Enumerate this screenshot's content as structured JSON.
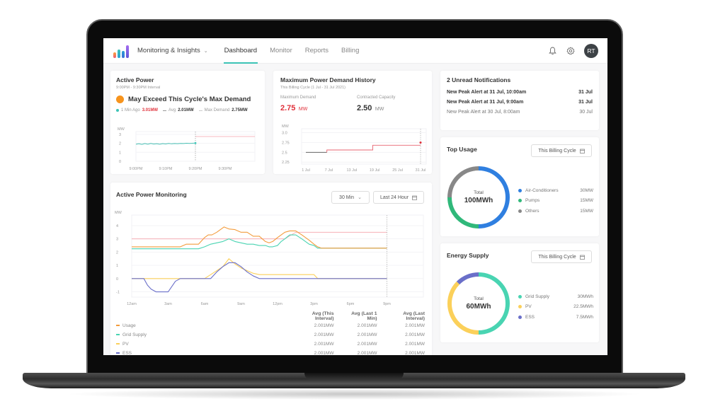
{
  "nav": {
    "module": "Monitoring & Insights",
    "tabs": [
      "Dashboard",
      "Monitor",
      "Reports",
      "Billing"
    ],
    "active_tab": "Dashboard",
    "avatar_initials": "RT",
    "icons": [
      "bell-icon",
      "gear-icon"
    ]
  },
  "colors": {
    "accent": "#3cc3b6",
    "usage": "#f39c3c",
    "grid_supply": "#49d4b2",
    "pv": "#fbd05a",
    "ess": "#6a6fc9",
    "alert_red": "#e0303a",
    "air_conditioners": "#2f7fe0",
    "pumps": "#30b87a",
    "others": "#888888"
  },
  "active_power": {
    "title": "Active Power",
    "interval": "9:00PM - 9:30PM Interval",
    "warning": "May Exceed This Cycle's Max Demand",
    "last_label": "1 Min Ago",
    "last_value": "3.01MW",
    "avg_label": "Avg",
    "avg_value": "2.01MW",
    "max_label": "Max Demand",
    "max_value": "2.75MW",
    "chart_data": {
      "type": "line",
      "ylabel": "MW",
      "yticks": [
        "3",
        "2",
        "1",
        "0"
      ],
      "ylim": [
        0,
        3.3
      ],
      "xticks": [
        "9:00PM",
        "9:10PM",
        "9:20PM",
        "9:30PM"
      ],
      "series": [
        {
          "name": "Usage",
          "x": [
            0,
            1,
            2,
            3,
            4,
            5,
            6,
            7,
            8,
            9,
            10,
            11,
            12,
            13,
            14,
            15,
            16,
            17,
            18,
            19,
            20
          ],
          "values": [
            1.9,
            1.95,
            1.88,
            1.97,
            1.9,
            1.98,
            1.92,
            1.95,
            1.9,
            1.96,
            1.93,
            1.98,
            1.94,
            1.97,
            1.95,
            1.98,
            1.97,
            2.0,
            1.98,
            2.0,
            2.02
          ]
        }
      ],
      "max_demand_line": 2.75,
      "current_marker_min": 20,
      "x_range_min": [
        0,
        40
      ]
    }
  },
  "max_demand": {
    "title": "Maximum Power Demand History",
    "subtitle": "This Billing Cycle (1 Jul - 31 Jul 2021)",
    "max_demand_label": "Maximum Demand",
    "max_demand_value": "2.75",
    "contracted_label": "Contracted Capacity",
    "contracted_value": "2.50",
    "unit": "MW",
    "chart_data": {
      "type": "line",
      "ylabel": "MW",
      "yticks": [
        "3.0",
        "2.75",
        "2.5",
        "2.25"
      ],
      "ylim": [
        2.2,
        3.1
      ],
      "xticks": [
        "1 Jul",
        "7 Jul",
        "13 Jul",
        "19 Jul",
        "25 Jul",
        "31 Jul"
      ],
      "steps": [
        {
          "day_from": 1,
          "day_to": 6.5,
          "value": 2.5
        },
        {
          "day_from": 6.5,
          "day_to": 18.5,
          "value": 2.56
        },
        {
          "day_from": 18.5,
          "day_to": 31,
          "value": 2.68
        }
      ],
      "marker": {
        "day": 31,
        "value": 2.75
      }
    }
  },
  "notifications": {
    "title": "2 Unread Notifications",
    "items": [
      {
        "text": "New Peak Alert at 31 Jul, 10:00am",
        "date": "31 Jul",
        "unread": true
      },
      {
        "text": "New Peak Alert at 31 Jul, 9:00am",
        "date": "31 Jul",
        "unread": true
      },
      {
        "text": "New Peak Alert at 30 Jul, 8:00am",
        "date": "30 Jul",
        "unread": false
      }
    ]
  },
  "top_usage": {
    "title": "Top Usage",
    "period": "This Billing Cycle",
    "total_label": "Total",
    "total_value": "100MWh",
    "chart_data": {
      "type": "pie",
      "labels": [
        "Air-Conditioners",
        "Pumps",
        "Others"
      ],
      "values": [
        50,
        25,
        25
      ],
      "display": [
        "30MW",
        "15MW",
        "15MW"
      ]
    }
  },
  "energy_supply": {
    "title": "Energy Supply",
    "period": "This Billing Cycle",
    "total_label": "Total",
    "total_value": "60MWh",
    "chart_data": {
      "type": "pie",
      "labels": [
        "Grid Supply",
        "PV",
        "ESS"
      ],
      "values": [
        30,
        22.5,
        7.5
      ],
      "display": [
        "30MWh",
        "22.5MWh",
        "7.5MWh"
      ]
    }
  },
  "monitoring": {
    "title": "Active Power Monitoring",
    "interval_select": "30 Min",
    "range_select": "Last 24 Hour",
    "chart_data": {
      "type": "line",
      "ylabel": "MW",
      "yticks": [
        "4",
        "3",
        "2",
        "1",
        "0",
        "-1"
      ],
      "ylim": [
        -1.4,
        4.8
      ],
      "xticks": [
        "12am",
        "3am",
        "6am",
        "9am",
        "12pm",
        "3pm",
        "6pm",
        "9pm"
      ],
      "x_range_hours": [
        0,
        24
      ],
      "now_hour": 21,
      "threshold": {
        "name": "Max Demand",
        "value": 3,
        "later_value": 3.5,
        "step_hour": 13.5
      },
      "series": [
        {
          "name": "Usage",
          "hours": [
            0,
            1,
            2,
            3,
            4,
            4.5,
            5,
            5.5,
            6,
            6.3,
            6.6,
            7,
            7.3,
            7.6,
            8,
            8.5,
            9,
            9.5,
            10,
            10.5,
            11,
            11.3,
            11.6,
            12,
            12.3,
            12.6,
            13,
            13.5,
            14,
            14.3,
            14.6,
            15,
            15.3,
            15.6,
            16,
            18,
            21
          ],
          "values": [
            2.4,
            2.4,
            2.4,
            2.4,
            2.4,
            2.6,
            2.6,
            2.6,
            3.1,
            3.3,
            3.3,
            3.5,
            3.7,
            3.9,
            3.75,
            3.7,
            3.5,
            3.5,
            3.2,
            3.2,
            2.8,
            2.7,
            2.8,
            3.1,
            3.3,
            3.5,
            3.6,
            3.6,
            3.3,
            3.1,
            2.9,
            2.6,
            2.4,
            2.3,
            2.3,
            2.3,
            2.3
          ]
        },
        {
          "name": "Grid Supply",
          "hours": [
            0,
            1,
            2,
            3,
            4,
            5,
            5.5,
            6,
            6.5,
            7,
            7.5,
            8,
            8.5,
            9,
            9.5,
            10,
            10.5,
            11,
            11.3,
            11.6,
            12,
            12.3,
            12.6,
            13,
            13.5,
            14,
            14.3,
            14.6,
            15,
            15.3,
            15.6,
            16,
            18,
            21
          ],
          "values": [
            2.25,
            2.25,
            2.25,
            2.25,
            2.25,
            2.25,
            2.25,
            2.4,
            2.6,
            2.7,
            2.8,
            3.0,
            2.8,
            2.7,
            2.6,
            2.6,
            2.5,
            2.5,
            2.4,
            2.4,
            2.5,
            2.8,
            3.0,
            3.3,
            3.3,
            3.0,
            2.8,
            2.6,
            2.5,
            2.3,
            2.3,
            2.3,
            2.3,
            2.3
          ]
        },
        {
          "name": "PV",
          "hours": [
            0,
            1,
            2,
            3,
            4,
            5,
            5.5,
            6,
            6.5,
            7,
            7.5,
            8,
            8.5,
            9,
            9.5,
            10,
            10.5,
            11,
            12,
            13,
            14,
            15,
            15.3,
            16,
            18,
            21
          ],
          "values": [
            0,
            0,
            0,
            0,
            0,
            0,
            0,
            0,
            0.3,
            0.6,
            0.9,
            1.5,
            1.1,
            0.8,
            0.6,
            0.4,
            0.3,
            0.3,
            0.3,
            0.3,
            0.3,
            0.3,
            0,
            0,
            0,
            0
          ]
        },
        {
          "name": "ESS",
          "hours": [
            0,
            0.5,
            1,
            1.3,
            1.6,
            2,
            2.5,
            3,
            3.3,
            3.6,
            4,
            5,
            6,
            6.5,
            7,
            7.5,
            8,
            8.5,
            9,
            9.5,
            10,
            10.5,
            11,
            12,
            15,
            18,
            21
          ],
          "values": [
            0,
            0,
            0,
            -0.5,
            -0.8,
            -1,
            -1,
            -1,
            -0.6,
            -0.2,
            0,
            0,
            0,
            0,
            0.5,
            0.9,
            1.2,
            1.2,
            0.9,
            0.5,
            0.2,
            0,
            0,
            0,
            0,
            0,
            0
          ]
        }
      ]
    },
    "table": {
      "headers": [
        "",
        "Avg (This Interval)",
        "Avg (Last 1 Min)",
        "Avg (Last Interval)"
      ],
      "rows": [
        {
          "series": "Usage",
          "values": [
            "2.001MW",
            "2.001MW",
            "2.001MW"
          ]
        },
        {
          "series": "Grid Supply",
          "values": [
            "2.001MW",
            "2.001MW",
            "2.001MW"
          ]
        },
        {
          "series": "PV",
          "values": [
            "2.001MW",
            "2.001MW",
            "2.001MW"
          ]
        },
        {
          "series": "ESS",
          "values": [
            "2.001MW",
            "2.001MW",
            "2.001MW"
          ]
        }
      ]
    }
  }
}
